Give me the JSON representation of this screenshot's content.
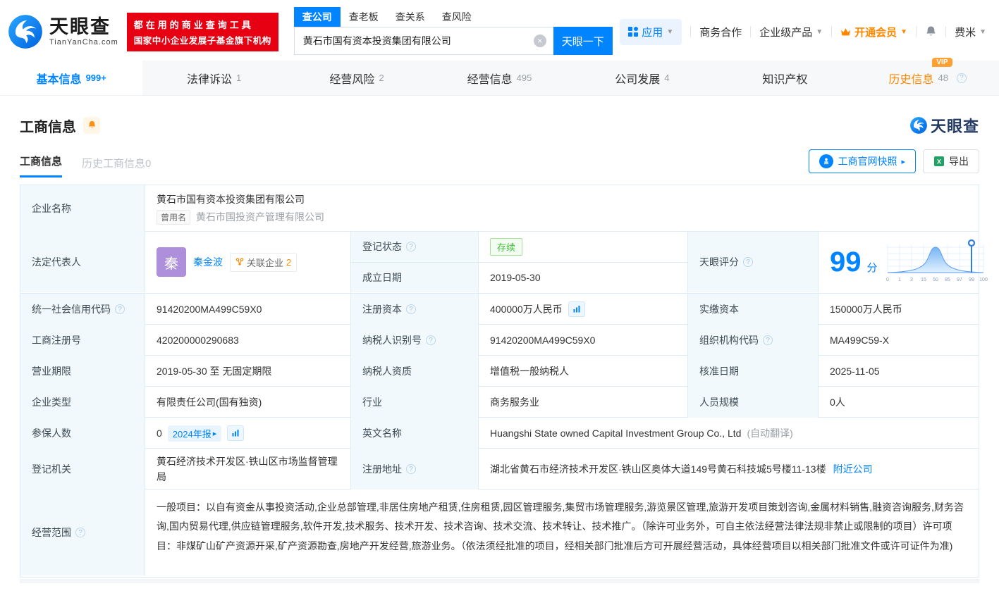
{
  "colors": {
    "primary": "#0084ff",
    "orange": "#ff8800",
    "red": "#e60012",
    "green": "#3dbd3d"
  },
  "header": {
    "logo_title": "天眼查",
    "logo_domain": "TianYanCha.com",
    "slogan_line1": "都在用的商业查询工具",
    "slogan_line2": "国家中小企业发展子基金旗下机构",
    "search_tabs": [
      {
        "label": "查公司"
      },
      {
        "label": "查老板"
      },
      {
        "label": "查关系"
      },
      {
        "label": "查风险"
      }
    ],
    "search_value": "黄石市国有资本投资集团有限公司",
    "search_button": "天眼一下",
    "nav_app": "应用",
    "nav_cooperation": "商务合作",
    "nav_enterprise": "企业级产品",
    "nav_vip": "开通会员",
    "nav_user": "费米"
  },
  "tabs": [
    {
      "label": "基本信息",
      "count": "999+"
    },
    {
      "label": "法律诉讼",
      "count": "1"
    },
    {
      "label": "经营风险",
      "count": "2"
    },
    {
      "label": "经营信息",
      "count": "495"
    },
    {
      "label": "公司发展",
      "count": "4"
    },
    {
      "label": "知识产权",
      "count": ""
    },
    {
      "label": "历史信息",
      "count": "48",
      "badge": "VIP"
    }
  ],
  "section": {
    "title": "工商信息",
    "subtab_current": "工商信息",
    "subtab_history": "历史工商信息0",
    "snapshot_button": "工商官网快照",
    "export_button": "导出",
    "watermark": "天眼查"
  },
  "table": {
    "company_name": {
      "label": "企业名称",
      "value": "黄石市国有资本投资集团有限公司",
      "former_tag": "曾用名",
      "former_value": "黄石市国投资产管理有限公司"
    },
    "legal_rep": {
      "label": "法定代表人",
      "avatar_char": "秦",
      "name": "秦金波",
      "related_label": "关联企业",
      "related_count": "2"
    },
    "reg_status": {
      "label": "登记状态",
      "value": "存续"
    },
    "establish_date": {
      "label": "成立日期",
      "value": "2019-05-30"
    },
    "score": {
      "label": "天眼评分",
      "value": "99",
      "unit": "分",
      "axis": [
        "0",
        "1",
        "3",
        "15",
        "50",
        "85",
        "97",
        "99",
        "100"
      ]
    },
    "credit_code": {
      "label": "统一社会信用代码",
      "value": "91420200MA499C59X0"
    },
    "reg_capital": {
      "label": "注册资本",
      "value": "400000万人民币"
    },
    "paid_capital": {
      "label": "实缴资本",
      "value": "150000万人民币"
    },
    "reg_number": {
      "label": "工商注册号",
      "value": "420200000290683"
    },
    "taxpayer_id": {
      "label": "纳税人识别号",
      "value": "91420200MA499C59X0"
    },
    "org_code": {
      "label": "组织机构代码",
      "value": "MA499C59-X"
    },
    "business_term": {
      "label": "营业期限",
      "value": "2019-05-30 至 无固定期限"
    },
    "taxpayer_quality": {
      "label": "纳税人资质",
      "value": "增值税一般纳税人"
    },
    "approval_date": {
      "label": "核准日期",
      "value": "2025-11-05"
    },
    "company_type": {
      "label": "企业类型",
      "value": "有限责任公司(国有独资)"
    },
    "industry": {
      "label": "行业",
      "value": "商务服务业"
    },
    "staff_size": {
      "label": "人员规模",
      "value": "0人"
    },
    "insured": {
      "label": "参保人数",
      "value": "0",
      "report_tag": "2024年报"
    },
    "english_name": {
      "label": "英文名称",
      "value": "Huangshi State owned Capital Investment Group Co., Ltd",
      "note": "(自动翻译)"
    },
    "authority": {
      "label": "登记机关",
      "value": "黄石经济技术开发区·铁山区市场监督管理局"
    },
    "address": {
      "label": "注册地址",
      "value": "湖北省黄石市经济技术开发区·铁山区奥体大道149号黄石科技城5号楼11-13楼",
      "link": "附近公司"
    },
    "scope": {
      "label": "经营范围",
      "value": "一般项目：以自有资金从事投资活动,企业总部管理,非居住房地产租赁,住房租赁,园区管理服务,集贸市场管理服务,游览景区管理,旅游开发项目策划咨询,金属材料销售,融资咨询服务,财务咨询,国内贸易代理,供应链管理服务,软件开发,技术服务、技术开发、技术咨询、技术交流、技术转让、技术推广。（除许可业务外，可自主依法经营法律法规非禁止或限制的项目）许可项目：非煤矿山矿产资源开采,矿产资源勘查,房地产开发经营,旅游业务。（依法须经批准的项目，经相关部门批准后方可开展经营活动，具体经营项目以相关部门批准文件或许可证件为准)"
    }
  }
}
